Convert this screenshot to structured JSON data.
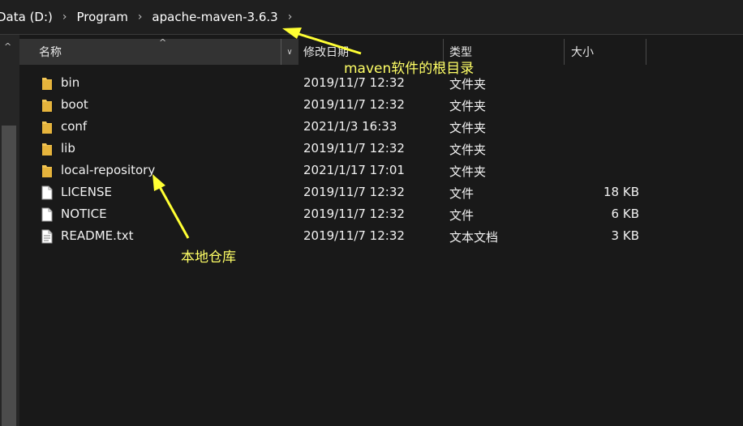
{
  "breadcrumb": {
    "items": [
      "Data (D:)",
      "Program",
      "apache-maven-3.6.3"
    ],
    "separator": "›"
  },
  "columns": {
    "name": "名称",
    "date": "修改日期",
    "type": "类型",
    "size": "大小"
  },
  "files": [
    {
      "name": "bin",
      "date": "2019/11/7 12:32",
      "type": "文件夹",
      "size": "",
      "icon": "folder-icon"
    },
    {
      "name": "boot",
      "date": "2019/11/7 12:32",
      "type": "文件夹",
      "size": "",
      "icon": "folder-icon"
    },
    {
      "name": "conf",
      "date": "2021/1/3 16:33",
      "type": "文件夹",
      "size": "",
      "icon": "folder-icon"
    },
    {
      "name": "lib",
      "date": "2019/11/7 12:32",
      "type": "文件夹",
      "size": "",
      "icon": "folder-icon"
    },
    {
      "name": "local-repository",
      "date": "2021/1/17 17:01",
      "type": "文件夹",
      "size": "",
      "icon": "folder-icon"
    },
    {
      "name": "LICENSE",
      "date": "2019/11/7 12:32",
      "type": "文件",
      "size": "18 KB",
      "icon": "file-icon"
    },
    {
      "name": "NOTICE",
      "date": "2019/11/7 12:32",
      "type": "文件",
      "size": "6 KB",
      "icon": "file-icon"
    },
    {
      "name": "README.txt",
      "date": "2019/11/7 12:32",
      "type": "文本文档",
      "size": "3 KB",
      "icon": "text-file-icon"
    }
  ],
  "annotations": {
    "root_dir": "maven软件的根目录",
    "local_repo": "本地仓库"
  },
  "colors": {
    "background": "#191919",
    "folder": "#f3c654",
    "annotation": "#ffff66"
  }
}
